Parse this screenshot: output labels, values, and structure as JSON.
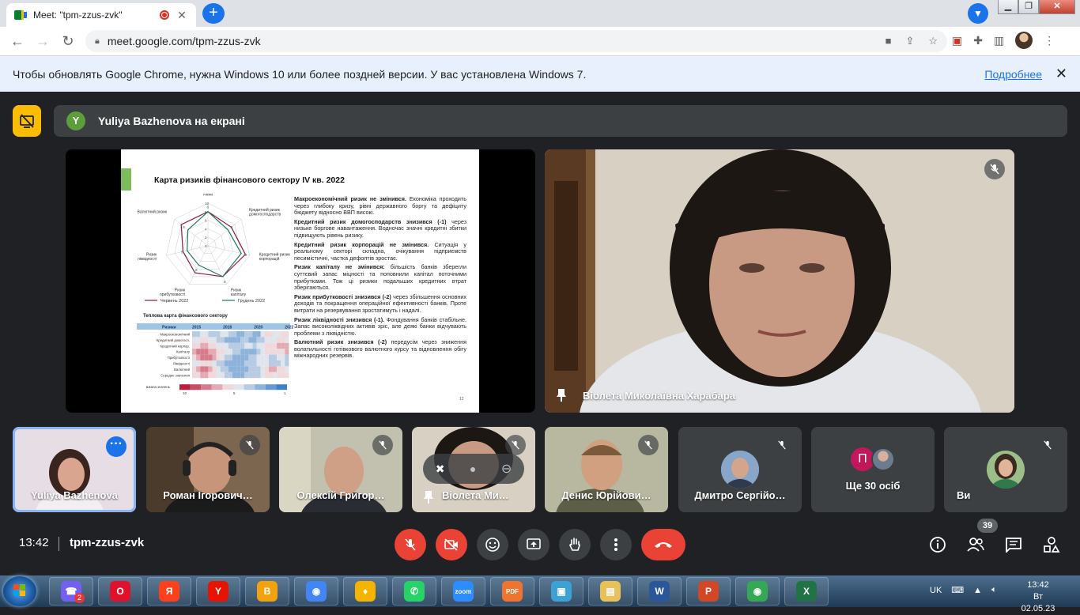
{
  "browser": {
    "tab_title": "Meet: \"tpm-zzus-zvk\"",
    "tab_close": "✕",
    "new_tab": "+",
    "url": "meet.google.com/tpm-zzus-zvk",
    "infobar_text": "Чтобы обновлять Google Chrome, нужна Windows 10 или более поздней версии. У вас установлена Windows 7.",
    "infobar_link": "Подробнее",
    "infobar_close": "✕"
  },
  "meet": {
    "presenter_avatar_letter": "Y",
    "presenting_banner": "Yuliya Bazhenova на екрані",
    "main_speaker_name": "Віолета Миколаївна Харабара",
    "time": "13:42",
    "meeting_code": "tpm-zzus-zvk",
    "people_count": "39",
    "tiles": [
      {
        "name": "Yuliya Bazhenova"
      },
      {
        "name": "Роман Ігорович…"
      },
      {
        "name": "Олексій Григор…"
      },
      {
        "name": "Віолета Ми…"
      },
      {
        "name": "Денис Юрійови…"
      },
      {
        "name": "Дмитро Сергійо…"
      },
      {
        "name": "Ще 30 осіб",
        "avatar_letter": "П"
      },
      {
        "name": "Ви"
      }
    ],
    "colors": {
      "accent": "#1a73e8",
      "danger": "#ea4335",
      "presenting": "#fbbc04",
      "surface": "#3c4043",
      "background": "#202124"
    }
  },
  "slide": {
    "title": "Карта ризиків фінансового сектору IV кв. 2022",
    "heatmap_title": "Теплова карта фінансового сектору",
    "page_number": "12",
    "paragraphs": [
      {
        "head": "Макроекономічний ризик не змінився.",
        "body": " Економіка проходить через глибоку кризу, рівні державного боргу та дефіциту бюджету відносно ВВП високі."
      },
      {
        "head": "Кредитний ризик домогосподарств знизився (-1)",
        "body": " через низьке боргове навантаження. Водночас значні кредитні збитки підвищують рівень ризику."
      },
      {
        "head": "Кредитний ризик корпорацій не змінився.",
        "body": " Ситуація у реальному секторі складна, очікування підприємств песимістичні, частка дефолтів зростає."
      },
      {
        "head": "Ризик капіталу не змінився:",
        "body": " більшість банків зберегли суттєвий запас міцності та поповнили капітал поточними прибутками. Тож ці ризики подальших кредитних втрат зберігаються."
      },
      {
        "head": "Ризик прибутковості знизився (-2)",
        "body": " через збільшення основних доходів та покращення операційної ефективності банків. Проте витрати на резервування зростатимуть і надалі."
      },
      {
        "head": "Ризик ліквідності знизився (-1).",
        "body": " Фондування банків стабільне. Запас високоліквідних активів зріс, але деякі банки відчувають проблеми з ліквідністю."
      },
      {
        "head": "Валютний ризик знизився (-2)",
        "body": " передусім через зниження волатильності готівкового валютного курсу та відновлення обігу міжнародних резервів."
      }
    ]
  },
  "chart_data": [
    {
      "type": "radar",
      "axes": [
        "Макроекономічний",
        "Кредитний ризик домогосподарств",
        "Кредитний ризик корпорацій",
        "Ризик капіталу",
        "Ризик прибутковості",
        "Ризик ліквідності",
        "Валютний ризик"
      ],
      "axis_labels": [
        [
          "Макроеконом",
          "ічний"
        ],
        [
          "Кредитний ризик",
          "домогосподарств"
        ],
        [
          "Кредитний ризик",
          "корпорацій"
        ],
        [
          "Ризик",
          "капіталу"
        ],
        [
          "Ризик",
          "прибутковості"
        ],
        [
          "Ризик",
          "ліквідності"
        ],
        [
          "Валютний ризик"
        ]
      ],
      "rlim": [
        0,
        10
      ],
      "ticks": [
        "10",
        "8",
        "6",
        "4",
        "2",
        "0"
      ],
      "data_labels": [
        "8",
        "9",
        "8",
        "8",
        "8",
        "5",
        "8"
      ],
      "series": [
        {
          "name": "Червень 2022",
          "color": "#8e1b3b",
          "values": [
            8,
            7,
            9,
            8,
            7,
            6,
            8
          ]
        },
        {
          "name": "Грудень 2022",
          "color": "#1e7a5a",
          "values": [
            8,
            6,
            8,
            8,
            5,
            5,
            6
          ]
        }
      ],
      "legend": "bottom"
    },
    {
      "type": "heatmap",
      "title": "Теплова карта фінансового сектору",
      "header": "Ризики",
      "year_labels": [
        "2015",
        "2018",
        "2020",
        "2022"
      ],
      "rows": [
        "Макроекономічний",
        "Кредитний домогосп.",
        "Кредитний корпор.",
        "Капіталу",
        "Прибутковості",
        "Ліквідності",
        "Валютний",
        "Середнє значення"
      ],
      "columns": 24,
      "legend_label": "Шкала значень",
      "legend_ticks": [
        "10",
        "5",
        "1"
      ],
      "scale": [
        10,
        1
      ],
      "values": [
        [
          4,
          4,
          5,
          5,
          4,
          4,
          4,
          5,
          5,
          4,
          4,
          3,
          3,
          4,
          4,
          3,
          3,
          5,
          6,
          6,
          5,
          5,
          6,
          6
        ],
        [
          5,
          5,
          6,
          6,
          5,
          5,
          4,
          4,
          3,
          3,
          3,
          3,
          4,
          4,
          3,
          3,
          4,
          4,
          5,
          5,
          5,
          6,
          6,
          5
        ],
        [
          6,
          6,
          7,
          7,
          6,
          6,
          5,
          5,
          5,
          4,
          4,
          4,
          4,
          5,
          5,
          4,
          5,
          5,
          6,
          6,
          6,
          7,
          7,
          7
        ],
        [
          7,
          8,
          8,
          8,
          7,
          7,
          6,
          6,
          5,
          5,
          4,
          4,
          3,
          3,
          3,
          3,
          4,
          5,
          6,
          6,
          6,
          6,
          6,
          7
        ],
        [
          6,
          7,
          8,
          8,
          8,
          7,
          6,
          5,
          4,
          4,
          3,
          3,
          3,
          3,
          4,
          4,
          5,
          5,
          5,
          4,
          4,
          5,
          5,
          4
        ],
        [
          5,
          5,
          6,
          6,
          6,
          5,
          4,
          4,
          3,
          3,
          3,
          3,
          3,
          4,
          4,
          4,
          5,
          5,
          5,
          4,
          4,
          4,
          5,
          4
        ],
        [
          6,
          7,
          8,
          8,
          7,
          6,
          5,
          4,
          4,
          3,
          3,
          3,
          3,
          3,
          4,
          4,
          4,
          5,
          6,
          7,
          7,
          6,
          6,
          5
        ],
        [
          6,
          6,
          7,
          7,
          6,
          6,
          5,
          5,
          4,
          4,
          3,
          3,
          3,
          4,
          4,
          4,
          4,
          5,
          6,
          6,
          5,
          6,
          6,
          6
        ]
      ]
    }
  ],
  "taskbar": {
    "lang": "UK",
    "time": "13:42",
    "date": "Вт 02.05.23",
    "viber_badge": "2",
    "apps": [
      "viber",
      "opera",
      "yandex",
      "yandex-y",
      "vpn",
      "chrome",
      "vpn-shield",
      "whatsapp",
      "zoom",
      "pdf",
      "box",
      "explorer",
      "word",
      "powerpoint",
      "chrome-alt",
      "excel"
    ]
  }
}
